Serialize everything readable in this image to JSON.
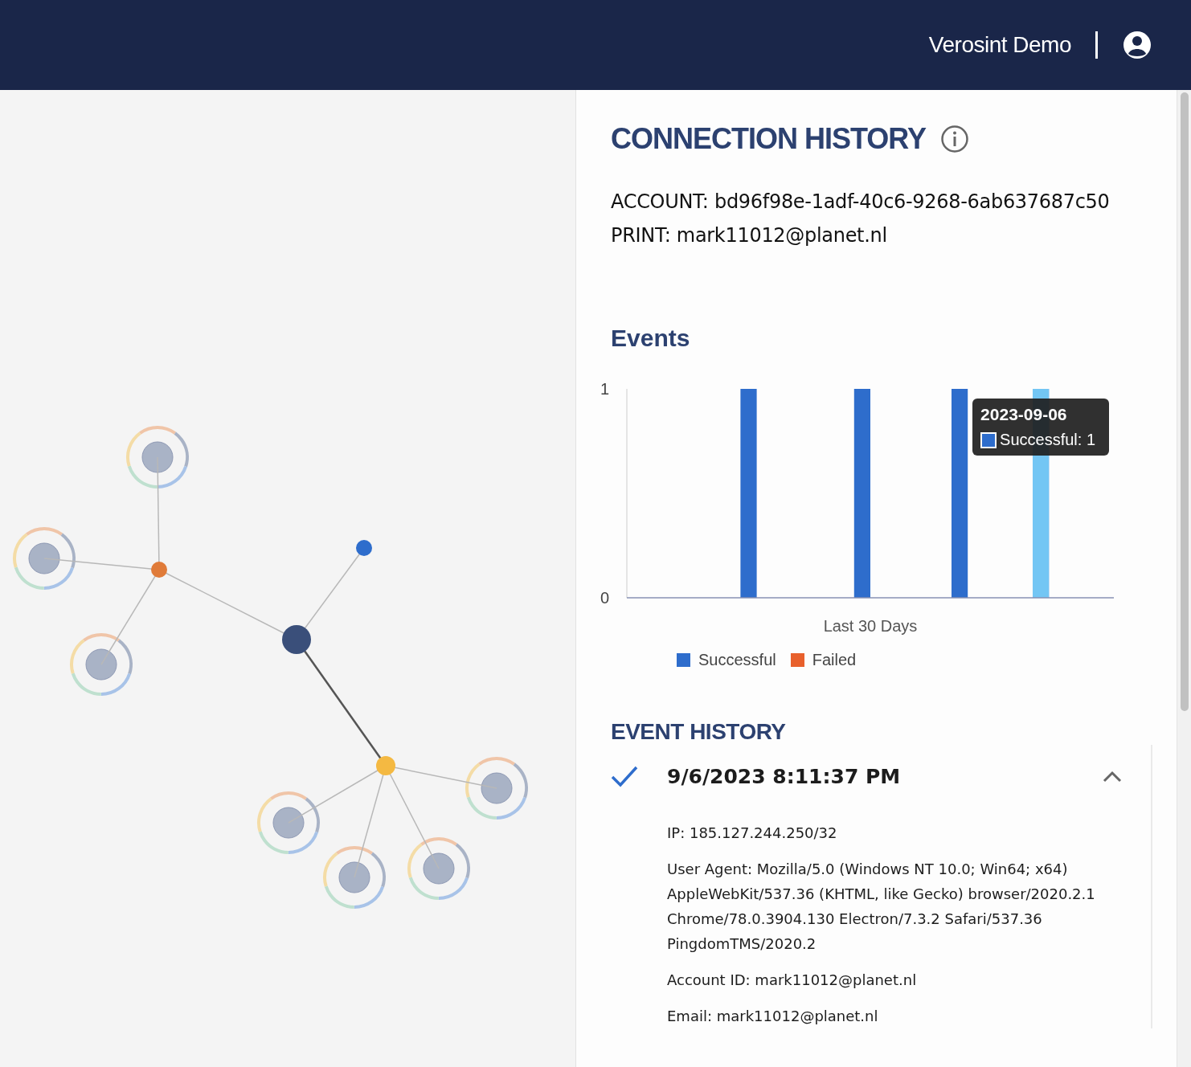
{
  "header": {
    "account_name": "Verosint Demo"
  },
  "panel": {
    "title": "CONNECTION HISTORY",
    "account_line": "ACCOUNT: bd96f98e-1adf-40c6-9268-6ab637687c50",
    "print_line": "PRINT: mark11012@planet.nl"
  },
  "events": {
    "title": "Events",
    "chart_data": {
      "type": "bar",
      "xlabel": "Last 30 Days",
      "ylim": [
        0,
        1
      ],
      "yticks": [
        0,
        1
      ],
      "stacked": true,
      "series": [
        {
          "name": "Successful",
          "color": "#2e6dcc",
          "values": [
            0,
            0,
            0,
            0,
            0,
            0,
            0,
            1,
            0,
            0,
            0,
            0,
            0,
            0,
            1,
            0,
            0,
            0,
            0,
            0,
            1,
            0,
            0,
            0,
            0,
            1,
            0,
            0,
            0,
            0
          ]
        },
        {
          "name": "Failed",
          "color": "#e8602c",
          "values": [
            0,
            0,
            0,
            0,
            0,
            0,
            0,
            0,
            0,
            0,
            0,
            0,
            0,
            0,
            0,
            0,
            0,
            0,
            0,
            0,
            0,
            0,
            0,
            0,
            0,
            0,
            0,
            0,
            0,
            0
          ]
        }
      ]
    },
    "tooltip": {
      "title": "2023-09-06",
      "text": "Successful: 1"
    }
  },
  "event_history": {
    "title": "EVENT HISTORY",
    "items": [
      {
        "kind": "success",
        "datetime": "9/6/2023 8:11:37 PM",
        "expanded": true,
        "details": [
          "IP: 185.127.244.250/32",
          "User Agent: Mozilla/5.0 (Windows NT 10.0; Win64; x64) AppleWebKit/537.36 (KHTML, like Gecko) browser/2020.2.1 Chrome/78.0.3904.130 Electron/7.3.2 Safari/537.36 PingdomTMS/2020.2",
          "Account ID: mark11012@planet.nl",
          "Email: mark11012@planet.nl"
        ]
      }
    ]
  }
}
